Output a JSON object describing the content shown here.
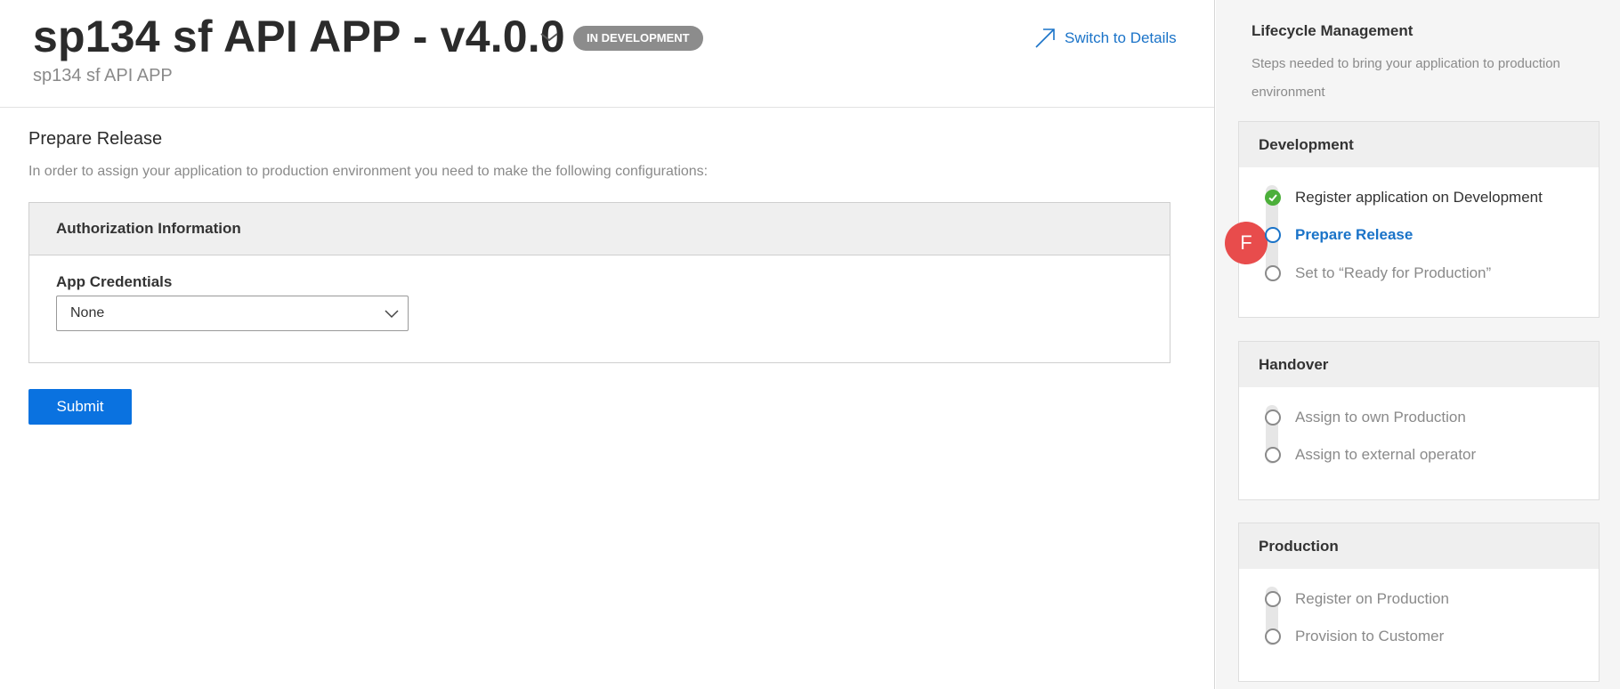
{
  "header": {
    "title": "sp134 sf API APP - v4.0.0",
    "subtitle": "sp134 sf API APP",
    "status_badge": "IN DEVELOPMENT",
    "switch_link": "Switch to Details"
  },
  "main": {
    "section_title": "Prepare Release",
    "section_description": "In order to assign your application to production environment you need to make the following configurations:",
    "panel_title": "Authorization Information",
    "field_label": "App Credentials",
    "field_value": "None",
    "submit_label": "Submit"
  },
  "lifecycle": {
    "title": "Lifecycle Management",
    "description": "Steps needed to bring your application to production environment",
    "stages": [
      {
        "name": "Development",
        "steps": [
          {
            "label": "Register application on Development",
            "state": "done"
          },
          {
            "label": "Prepare Release",
            "state": "current"
          },
          {
            "label": "Set to “Ready for Production”",
            "state": "todo"
          }
        ]
      },
      {
        "name": "Handover",
        "steps": [
          {
            "label": "Assign to own Production",
            "state": "todo"
          },
          {
            "label": "Assign to external operator",
            "state": "todo"
          }
        ]
      },
      {
        "name": "Production",
        "steps": [
          {
            "label": "Register on Production",
            "state": "todo"
          },
          {
            "label": "Provision to Customer",
            "state": "todo"
          }
        ]
      }
    ]
  },
  "marker": {
    "label": "F"
  },
  "colors": {
    "accent": "#0a72e0",
    "link": "#1a73c8",
    "done": "#4caf3a",
    "badge": "#8c8c8c",
    "marker": "#e84c4c"
  }
}
